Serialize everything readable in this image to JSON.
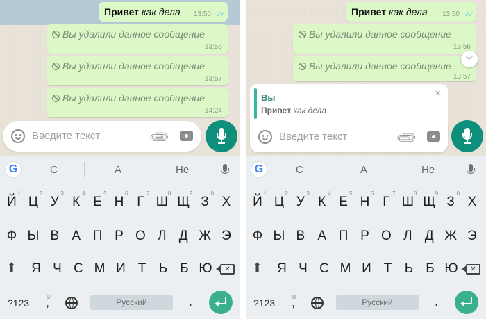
{
  "messages": {
    "first": {
      "bold": "Привет",
      "italic": "как дела",
      "time": "13:50"
    },
    "deleted_text": "Вы удалили данное сообщение",
    "deleted_times": [
      "13:56",
      "13:57",
      "14:24"
    ],
    "right_deleted_times": [
      "13:56",
      "13:57"
    ]
  },
  "reply": {
    "author": "Вы",
    "quote_bold": "Привет",
    "quote_italic": "как дела",
    "close": "×"
  },
  "input": {
    "placeholder": "Введите текст"
  },
  "keyboard": {
    "suggestions": [
      "С",
      "А",
      "Не"
    ],
    "row1": [
      "Й",
      "Ц",
      "У",
      "К",
      "Е",
      "Н",
      "Г",
      "Ш",
      "Щ",
      "З",
      "Х"
    ],
    "row1_hints": [
      "1",
      "2",
      "3",
      "4",
      "5",
      "6",
      "7",
      "8",
      "9",
      "0"
    ],
    "row2": [
      "Ф",
      "Ы",
      "В",
      "А",
      "П",
      "Р",
      "О",
      "Л",
      "Д",
      "Ж",
      "Э"
    ],
    "row3": [
      "Я",
      "Ч",
      "С",
      "М",
      "И",
      "Т",
      "Ь",
      "Б",
      "Ю"
    ],
    "symbols_key": "?123",
    "comma_key": ",",
    "space_label": "Русский",
    "period_key": "."
  },
  "colors": {
    "bubble": "#dcf8c6",
    "accent": "#0e8f7b",
    "check": "#4fc3f7",
    "reply_bar": "#35b89b"
  },
  "icons": [
    "ban-icon",
    "double-check-icon",
    "emoji-icon",
    "paperclip-icon",
    "camera-icon",
    "mic-icon",
    "google-icon",
    "shift-icon",
    "backspace-icon",
    "globe-icon",
    "enter-icon",
    "chevron-down-icon",
    "close-icon"
  ]
}
